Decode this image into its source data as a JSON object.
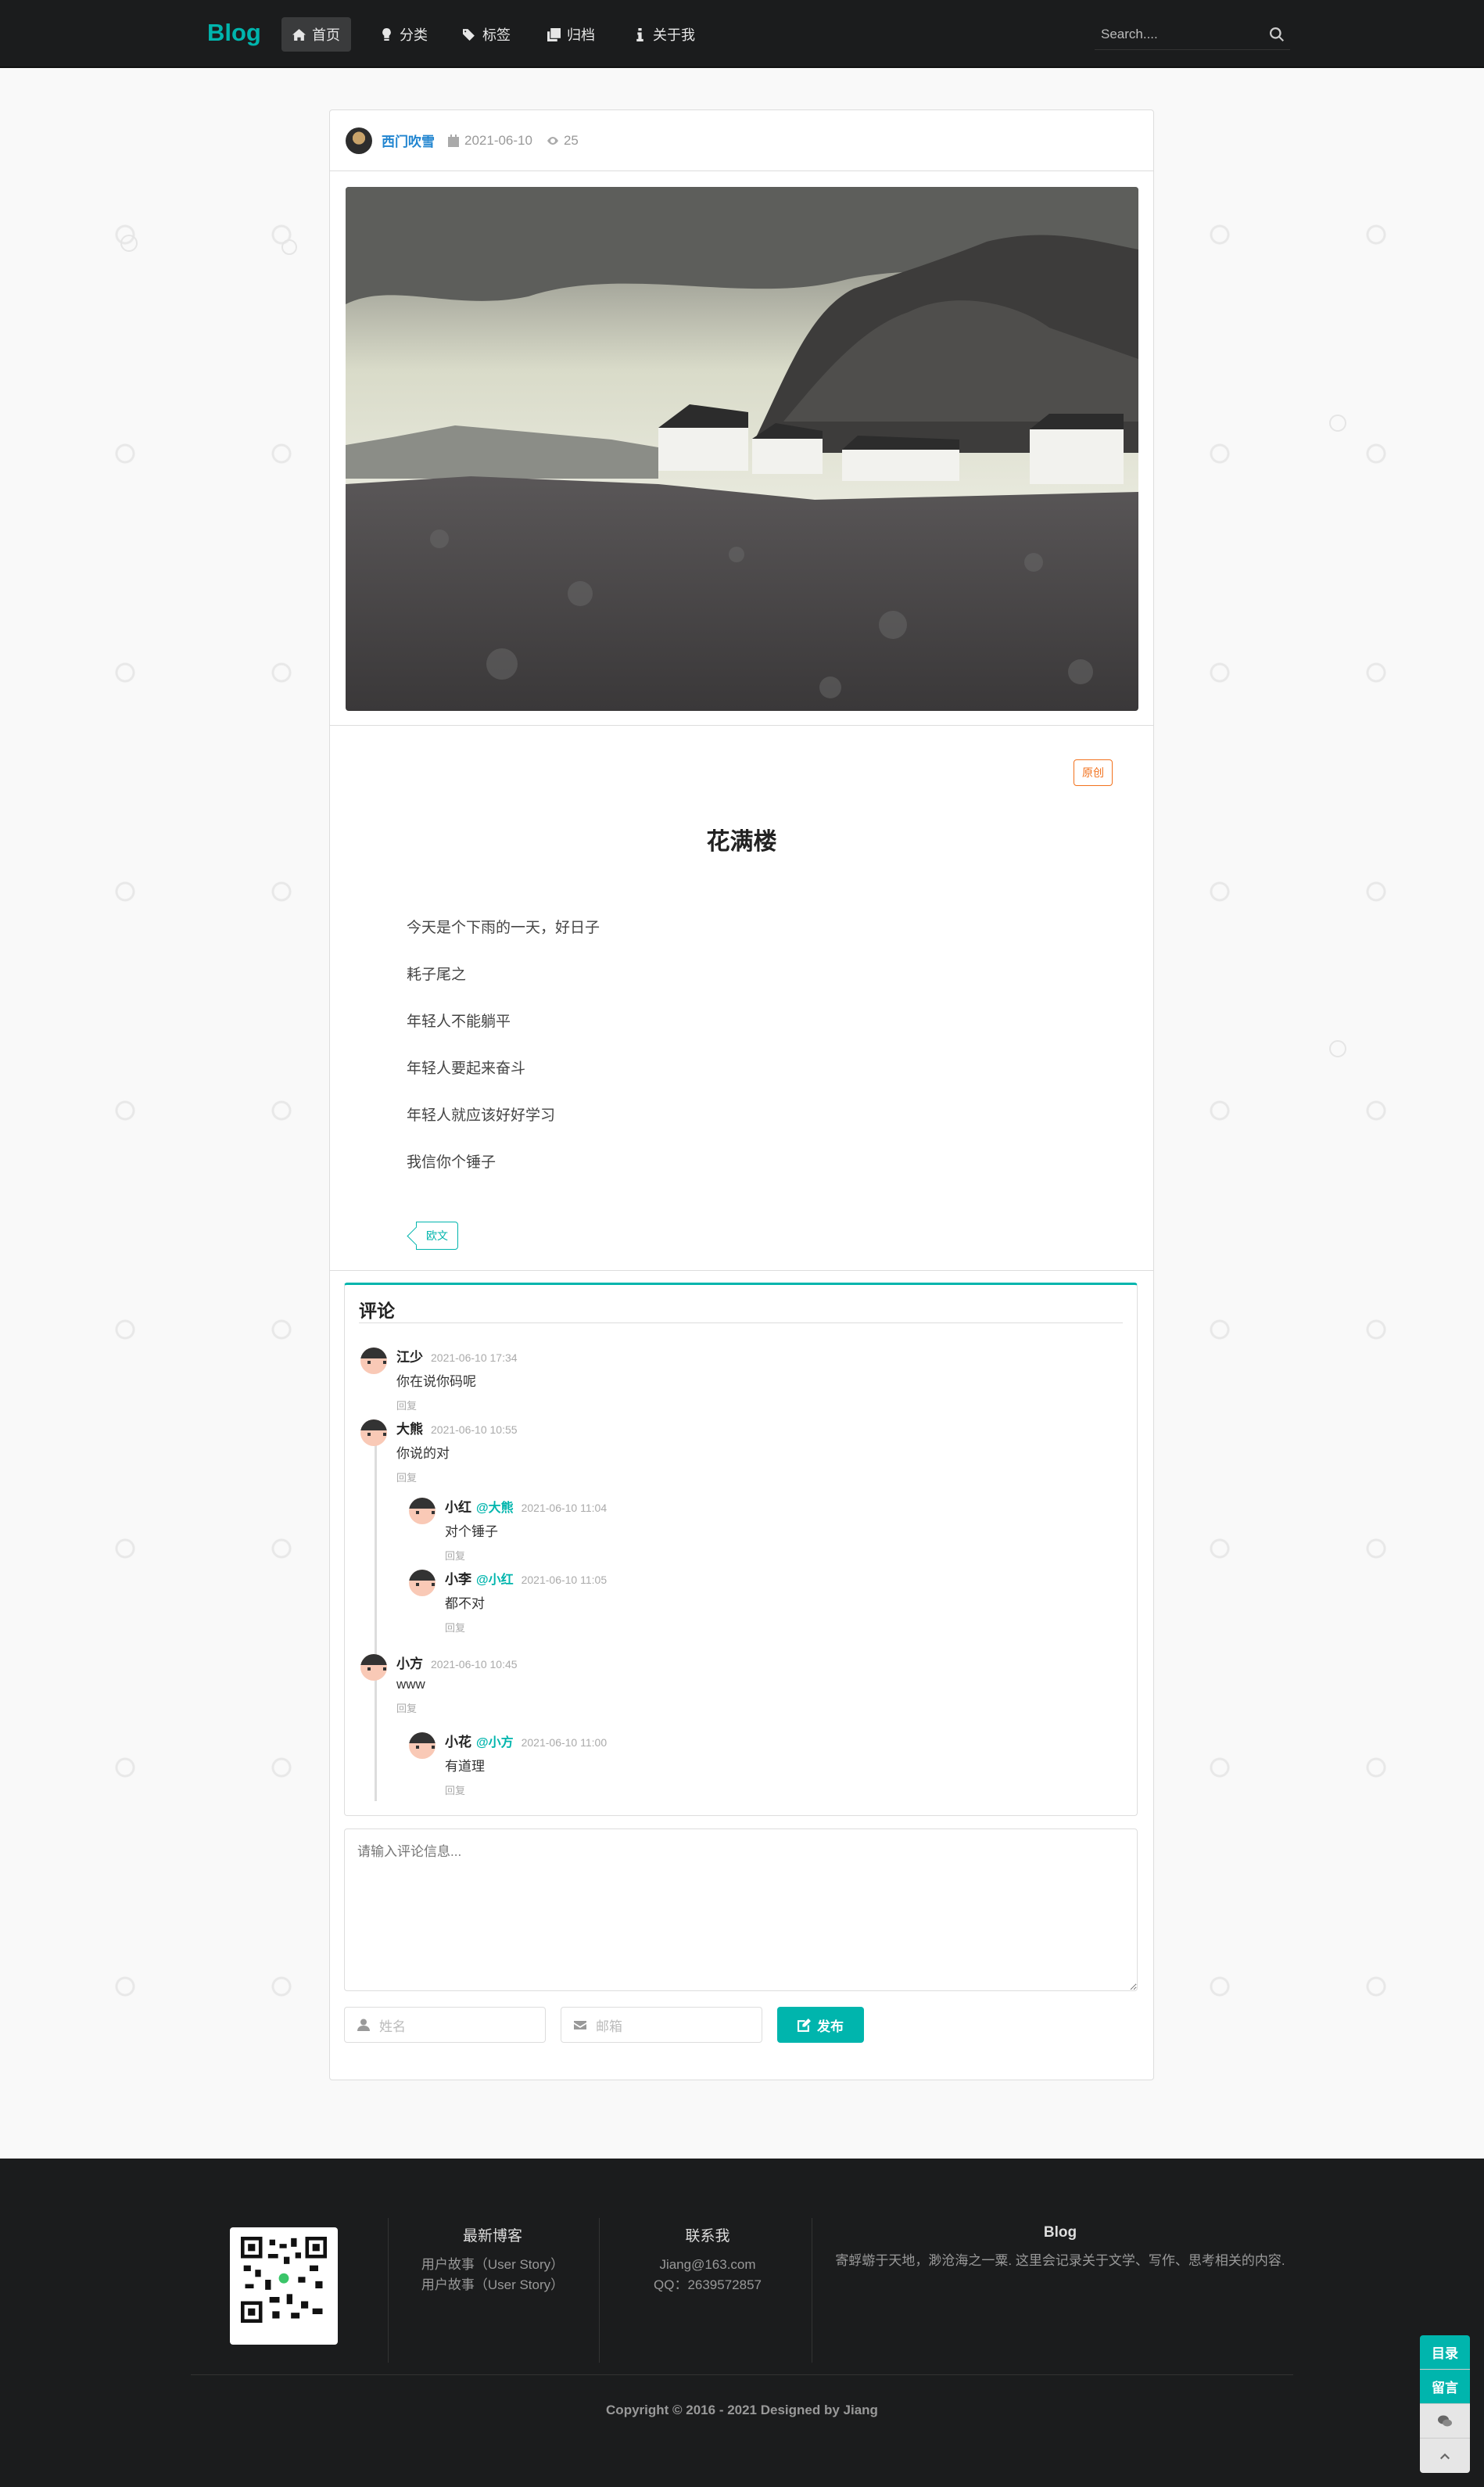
{
  "nav": {
    "brand": "Blog",
    "items": [
      {
        "label": "首页",
        "icon": "home-icon",
        "active": true
      },
      {
        "label": "分类",
        "icon": "idea-icon"
      },
      {
        "label": "标签",
        "icon": "tags-icon"
      },
      {
        "label": "归档",
        "icon": "clone-icon"
      },
      {
        "label": "关于我",
        "icon": "info-icon"
      }
    ],
    "search_placeholder": "Search...."
  },
  "post": {
    "author": "西门吹雪",
    "date": "2021-06-10",
    "views": "25",
    "badge": "原创",
    "title": "花满楼",
    "paragraphs": [
      "今天是个下雨的一天，好日子",
      "耗子尾之",
      "年轻人不能躺平",
      "年轻人要起来奋斗",
      "年轻人就应该好好学习",
      "我信你个锤子"
    ],
    "tag": "欧文"
  },
  "comments": {
    "title": "评论",
    "reply_label": "回复",
    "items": [
      {
        "name": "江少",
        "date": "2021-06-10 17:34",
        "text": "你在说你码呢"
      },
      {
        "name": "大熊",
        "date": "2021-06-10 10:55",
        "text": "你说的对"
      },
      {
        "name": "小红",
        "to": "@大熊",
        "date": "2021-06-10 11:04",
        "text": "对个锤子"
      },
      {
        "name": "小李",
        "to": "@小红",
        "date": "2021-06-10 11:05",
        "text": "都不对"
      },
      {
        "name": "小方",
        "date": "2021-06-10 10:45",
        "text": "www"
      },
      {
        "name": "小花",
        "to": "@小方",
        "date": "2021-06-10 11:00",
        "text": "有道理"
      }
    ]
  },
  "form": {
    "textarea_placeholder": "请输入评论信息...",
    "name_placeholder": "姓名",
    "email_placeholder": "邮箱",
    "submit": "发布"
  },
  "footer": {
    "latest_title": "最新博客",
    "latest_items": [
      "用户故事（User Story）",
      "用户故事（User Story）"
    ],
    "contact_title": "联系我",
    "contact_email": "Jiang@163.com",
    "contact_qq": "QQ：2639572857",
    "blog_title": "Blog",
    "blog_desc": "寄蜉蝣于天地，渺沧海之一粟. 这里会记录关于文学、写作、思考相关的内容.",
    "copyright": "Copyright © 2016 - 2021 Designed by Jiang"
  },
  "side": {
    "toc": "目录",
    "msg": "留言",
    "wechat_icon": "wechat-icon",
    "top_icon": "chevron-up-icon"
  }
}
